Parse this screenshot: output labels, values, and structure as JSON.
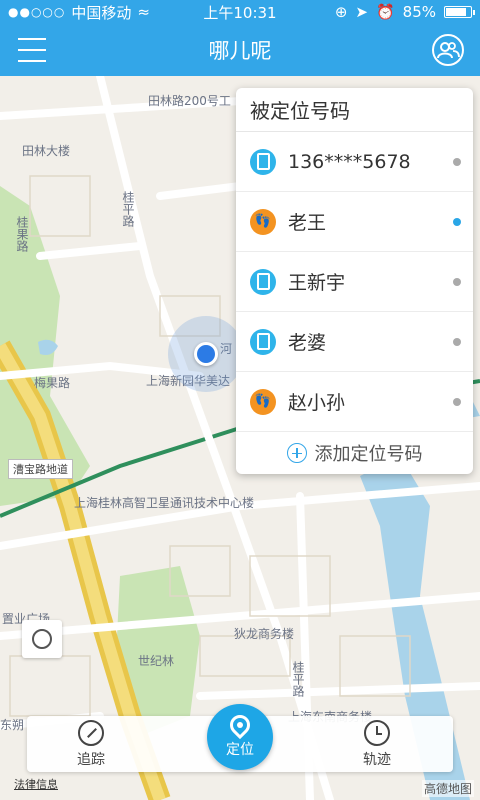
{
  "status_bar": {
    "signal_dots": "●●○○○",
    "carrier": "中国移动",
    "time": "上午10:31",
    "battery_percent": "85%",
    "battery_level": 0.85
  },
  "nav": {
    "title": "哪儿呢"
  },
  "panel": {
    "title": "被定位号码",
    "contacts": [
      {
        "name": "136****5678",
        "icon": "phone-icon",
        "active": false
      },
      {
        "name": "老王",
        "icon": "elder-icon",
        "active": true
      },
      {
        "name": "王新宇",
        "icon": "phone-icon",
        "active": false
      },
      {
        "name": "老婆",
        "icon": "phone-icon",
        "active": false
      },
      {
        "name": "赵小孙",
        "icon": "elder-icon",
        "active": false
      }
    ],
    "add_label": "添加定位号码"
  },
  "map_labels": {
    "l1": "田林路200号工",
    "l2": "田林大楼",
    "l3": "桂果路",
    "l4": "桂平路",
    "l5": "梅果路",
    "l6": "上海新园华美达",
    "l7": "漕宝路地道",
    "l8": "上海桂林高智卫星通讯技术中心楼",
    "l9": "置业广场",
    "l10": "世纪林",
    "l11": "狄龙商务楼",
    "l12": "桂平路",
    "l13": "东朔",
    "l14": "上海东南商务楼",
    "l15": "河"
  },
  "bottom": {
    "track_label": "追踪",
    "locate_label": "定位",
    "history_label": "轨迹"
  },
  "legal": "法律信息",
  "amap": "高德地图",
  "colors": {
    "primary": "#33a6e8",
    "phone_icon": "#2fb4ea",
    "elder_icon": "#f39321",
    "active_dot": "#2aa6e6"
  }
}
